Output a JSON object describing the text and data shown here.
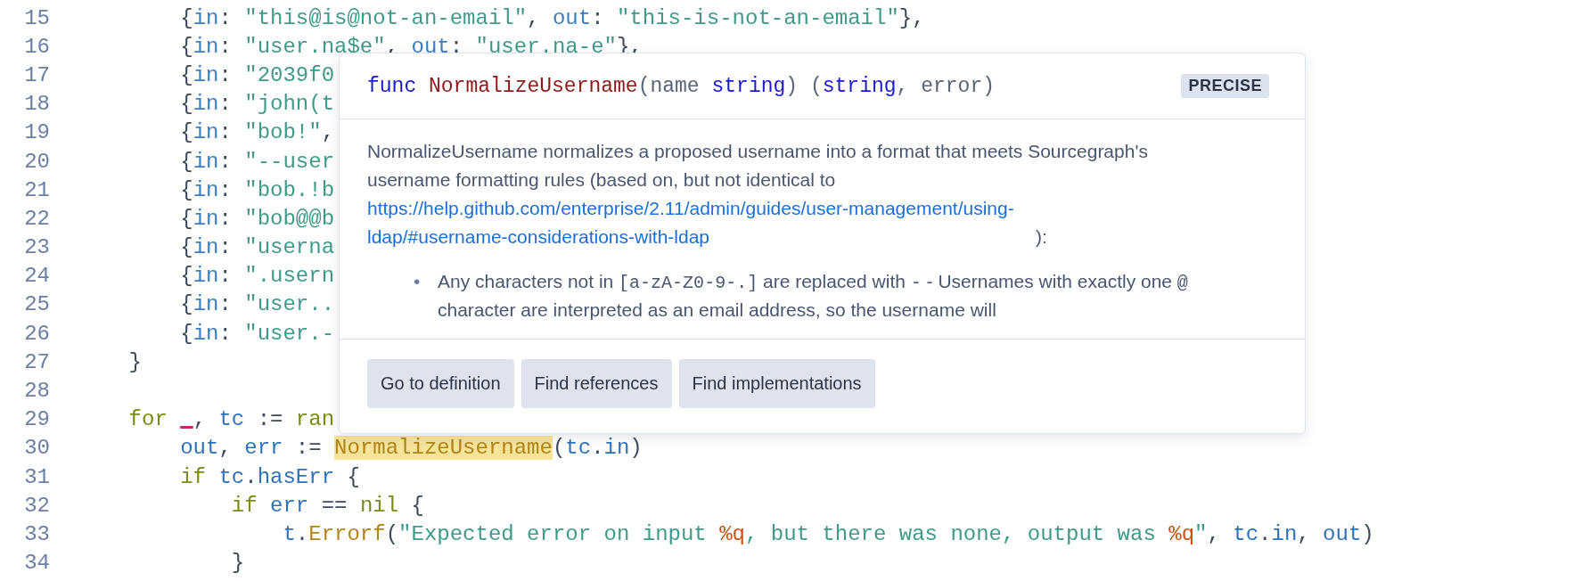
{
  "code": {
    "lines": [
      {
        "number": "15",
        "tokens": [
          {
            "text": "        {",
            "kind": "punct"
          },
          {
            "text": "in",
            "kind": "key"
          },
          {
            "text": ": ",
            "kind": "punct"
          },
          {
            "text": "\"this@is@not-an-email\"",
            "kind": "string"
          },
          {
            "text": ", ",
            "kind": "punct"
          },
          {
            "text": "out",
            "kind": "key"
          },
          {
            "text": ": ",
            "kind": "punct"
          },
          {
            "text": "\"this-is-not-an-email\"",
            "kind": "string"
          },
          {
            "text": "},",
            "kind": "punct"
          }
        ]
      },
      {
        "number": "16",
        "tokens": [
          {
            "text": "        {",
            "kind": "punct"
          },
          {
            "text": "in",
            "kind": "key"
          },
          {
            "text": ": ",
            "kind": "punct"
          },
          {
            "text": "\"user.na$e\"",
            "kind": "string"
          },
          {
            "text": ", ",
            "kind": "punct"
          },
          {
            "text": "out",
            "kind": "key"
          },
          {
            "text": ": ",
            "kind": "punct"
          },
          {
            "text": "\"user.na-e\"",
            "kind": "string"
          },
          {
            "text": "},",
            "kind": "punct"
          }
        ]
      },
      {
        "number": "17",
        "tokens": [
          {
            "text": "        {",
            "kind": "punct"
          },
          {
            "text": "in",
            "kind": "key"
          },
          {
            "text": ": ",
            "kind": "punct"
          },
          {
            "text": "\"2039f0",
            "kind": "string"
          }
        ]
      },
      {
        "number": "18",
        "tokens": [
          {
            "text": "        {",
            "kind": "punct"
          },
          {
            "text": "in",
            "kind": "key"
          },
          {
            "text": ": ",
            "kind": "punct"
          },
          {
            "text": "\"john(t",
            "kind": "string"
          }
        ]
      },
      {
        "number": "19",
        "tokens": [
          {
            "text": "        {",
            "kind": "punct"
          },
          {
            "text": "in",
            "kind": "key"
          },
          {
            "text": ": ",
            "kind": "punct"
          },
          {
            "text": "\"bob!\"",
            "kind": "string"
          },
          {
            "text": ",",
            "kind": "punct"
          }
        ]
      },
      {
        "number": "20",
        "tokens": [
          {
            "text": "        {",
            "kind": "punct"
          },
          {
            "text": "in",
            "kind": "key"
          },
          {
            "text": ": ",
            "kind": "punct"
          },
          {
            "text": "\"--user",
            "kind": "string"
          }
        ]
      },
      {
        "number": "21",
        "tokens": [
          {
            "text": "        {",
            "kind": "punct"
          },
          {
            "text": "in",
            "kind": "key"
          },
          {
            "text": ": ",
            "kind": "punct"
          },
          {
            "text": "\"bob.!b",
            "kind": "string"
          }
        ]
      },
      {
        "number": "22",
        "tokens": [
          {
            "text": "        {",
            "kind": "punct"
          },
          {
            "text": "in",
            "kind": "key"
          },
          {
            "text": ": ",
            "kind": "punct"
          },
          {
            "text": "\"bob@@b",
            "kind": "string"
          }
        ]
      },
      {
        "number": "23",
        "tokens": [
          {
            "text": "        {",
            "kind": "punct"
          },
          {
            "text": "in",
            "kind": "key"
          },
          {
            "text": ": ",
            "kind": "punct"
          },
          {
            "text": "\"userna",
            "kind": "string"
          }
        ]
      },
      {
        "number": "24",
        "tokens": [
          {
            "text": "        {",
            "kind": "punct"
          },
          {
            "text": "in",
            "kind": "key"
          },
          {
            "text": ": ",
            "kind": "punct"
          },
          {
            "text": "\".usern",
            "kind": "string"
          }
        ]
      },
      {
        "number": "25",
        "tokens": [
          {
            "text": "        {",
            "kind": "punct"
          },
          {
            "text": "in",
            "kind": "key"
          },
          {
            "text": ": ",
            "kind": "punct"
          },
          {
            "text": "\"user..",
            "kind": "string"
          }
        ]
      },
      {
        "number": "26",
        "tokens": [
          {
            "text": "        {",
            "kind": "punct"
          },
          {
            "text": "in",
            "kind": "key"
          },
          {
            "text": ": ",
            "kind": "punct"
          },
          {
            "text": "\"user.-",
            "kind": "string"
          }
        ]
      },
      {
        "number": "27",
        "tokens": [
          {
            "text": "    }",
            "kind": "punct"
          }
        ]
      },
      {
        "number": "28"
      },
      {
        "number": "29",
        "tokens": [
          {
            "text": "    for ",
            "kind": "keyword"
          },
          {
            "text": "_",
            "kind": "blank"
          },
          {
            "text": ", ",
            "kind": "punct"
          },
          {
            "text": "tc",
            "kind": "var"
          },
          {
            "text": " := ",
            "kind": "punct"
          },
          {
            "text": "ran",
            "kind": "keyword"
          }
        ]
      },
      {
        "number": "30",
        "tokens": [
          {
            "text": "        out",
            "kind": "var"
          },
          {
            "text": ", ",
            "kind": "punct"
          },
          {
            "text": "err",
            "kind": "var"
          },
          {
            "text": " := ",
            "kind": "punct"
          },
          {
            "text": "NormalizeUsername",
            "kind": "func",
            "highlighted": true
          },
          {
            "text": "(",
            "kind": "punct"
          },
          {
            "text": "tc",
            "kind": "var"
          },
          {
            "text": ".",
            "kind": "punct"
          },
          {
            "text": "in",
            "kind": "var"
          },
          {
            "text": ")",
            "kind": "punct"
          }
        ]
      },
      {
        "number": "31",
        "tokens": [
          {
            "text": "        if ",
            "kind": "keyword"
          },
          {
            "text": "tc",
            "kind": "var"
          },
          {
            "text": ".",
            "kind": "punct"
          },
          {
            "text": "hasErr",
            "kind": "var"
          },
          {
            "text": " {",
            "kind": "punct"
          }
        ]
      },
      {
        "number": "32",
        "tokens": [
          {
            "text": "            if ",
            "kind": "keyword"
          },
          {
            "text": "err",
            "kind": "var"
          },
          {
            "text": " == ",
            "kind": "punct"
          },
          {
            "text": "nil",
            "kind": "keyword"
          },
          {
            "text": " {",
            "kind": "punct"
          }
        ]
      },
      {
        "number": "33",
        "tokens": [
          {
            "text": "                t",
            "kind": "var"
          },
          {
            "text": ".",
            "kind": "punct"
          },
          {
            "text": "Errorf",
            "kind": "func"
          },
          {
            "text": "(",
            "kind": "punct"
          },
          {
            "text": "\"Expected error on input ",
            "kind": "string"
          },
          {
            "text": "%q",
            "kind": "format"
          },
          {
            "text": ", but there was none, output was ",
            "kind": "string"
          },
          {
            "text": "%q",
            "kind": "format"
          },
          {
            "text": "\"",
            "kind": "string"
          },
          {
            "text": ", ",
            "kind": "punct"
          },
          {
            "text": "tc",
            "kind": "var"
          },
          {
            "text": ".",
            "kind": "punct"
          },
          {
            "text": "in",
            "kind": "var"
          },
          {
            "text": ", ",
            "kind": "punct"
          },
          {
            "text": "out",
            "kind": "var"
          },
          {
            "text": ")",
            "kind": "punct"
          }
        ]
      },
      {
        "number": "34",
        "tokens": [
          {
            "text": "            }",
            "kind": "punct"
          }
        ]
      }
    ]
  },
  "hover_popup": {
    "signature": [
      {
        "text": "func ",
        "kind": "keyword"
      },
      {
        "text": "NormalizeUsername",
        "kind": "name"
      },
      {
        "text": "(name ",
        "kind": "punct"
      },
      {
        "text": "string",
        "kind": "keyword"
      },
      {
        "text": ") (",
        "kind": "punct"
      },
      {
        "text": "string",
        "kind": "keyword"
      },
      {
        "text": ", error)",
        "kind": "punct"
      }
    ],
    "badge": "PRECISE",
    "description": {
      "text": "NormalizeUsername normalizes a proposed username into a format that meets Sourcegraph's username formatting rules (based on, but not identical to",
      "link": "https://help.github.com/enterprise/2.11/admin/guides/user-management/using-ldap/#username-considerations-with-ldap",
      "after": "):"
    },
    "bullets": [
      {
        "marker": "•",
        "segments": [
          {
            "text": "Any characters not in ",
            "kind": "text"
          },
          {
            "text": "[a-zA-Z0-9-.]",
            "kind": "code"
          },
          {
            "text": " are replaced with ",
            "kind": "text"
          },
          {
            "text": "-",
            "kind": "code"
          },
          {
            "text": " - Usernames with exactly one ",
            "kind": "text"
          },
          {
            "text": "@",
            "kind": "code"
          },
          {
            "text": " character are interpreted as an email address, so the username will",
            "kind": "text"
          }
        ]
      }
    ],
    "actions": [
      "Go to definition",
      "Find references",
      "Find implementations"
    ]
  }
}
